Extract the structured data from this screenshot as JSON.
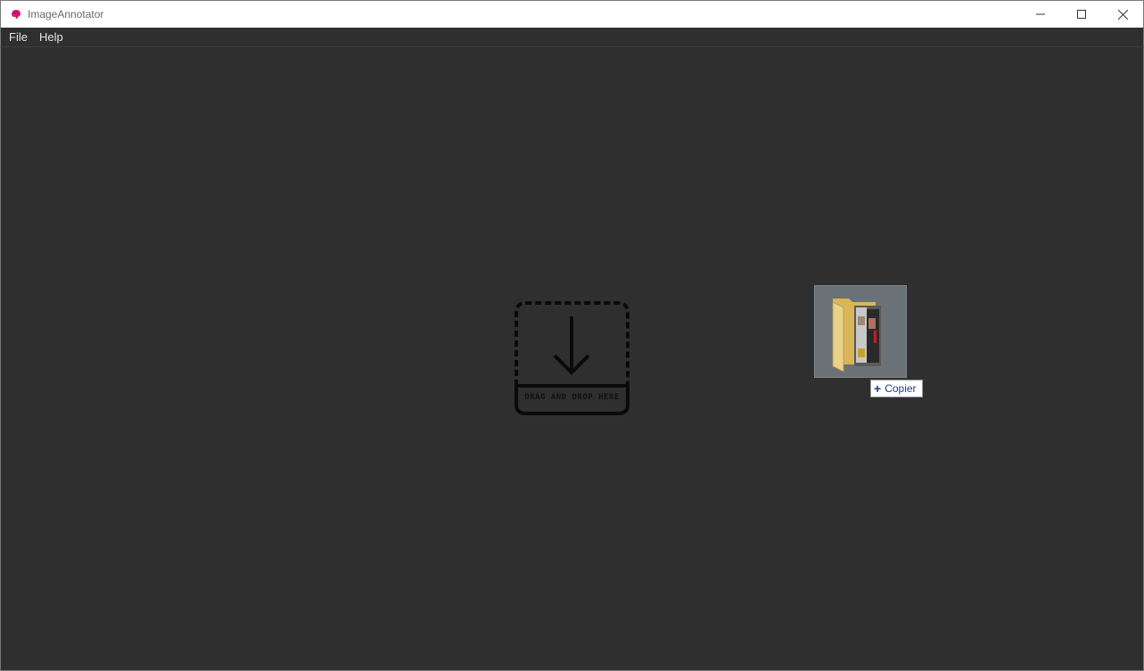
{
  "window": {
    "title": "ImageAnnotator",
    "icon": "brain-icon",
    "controls": [
      "minimize-icon",
      "maximize-icon",
      "close-icon"
    ]
  },
  "menubar": {
    "file": "File",
    "help": "Help"
  },
  "dropzone": {
    "icon": "download-arrow-icon",
    "label": "DRAG AND DROP HERE"
  },
  "drag": {
    "icon": "folder-with-images-icon",
    "action_label": "Copier",
    "action_icon": "plus-icon"
  },
  "colors": {
    "background": "#2f2f2f",
    "menu_text": "#e6e6e6",
    "app_icon": "#d6187a",
    "tooltip_text": "#1a3f8f"
  }
}
